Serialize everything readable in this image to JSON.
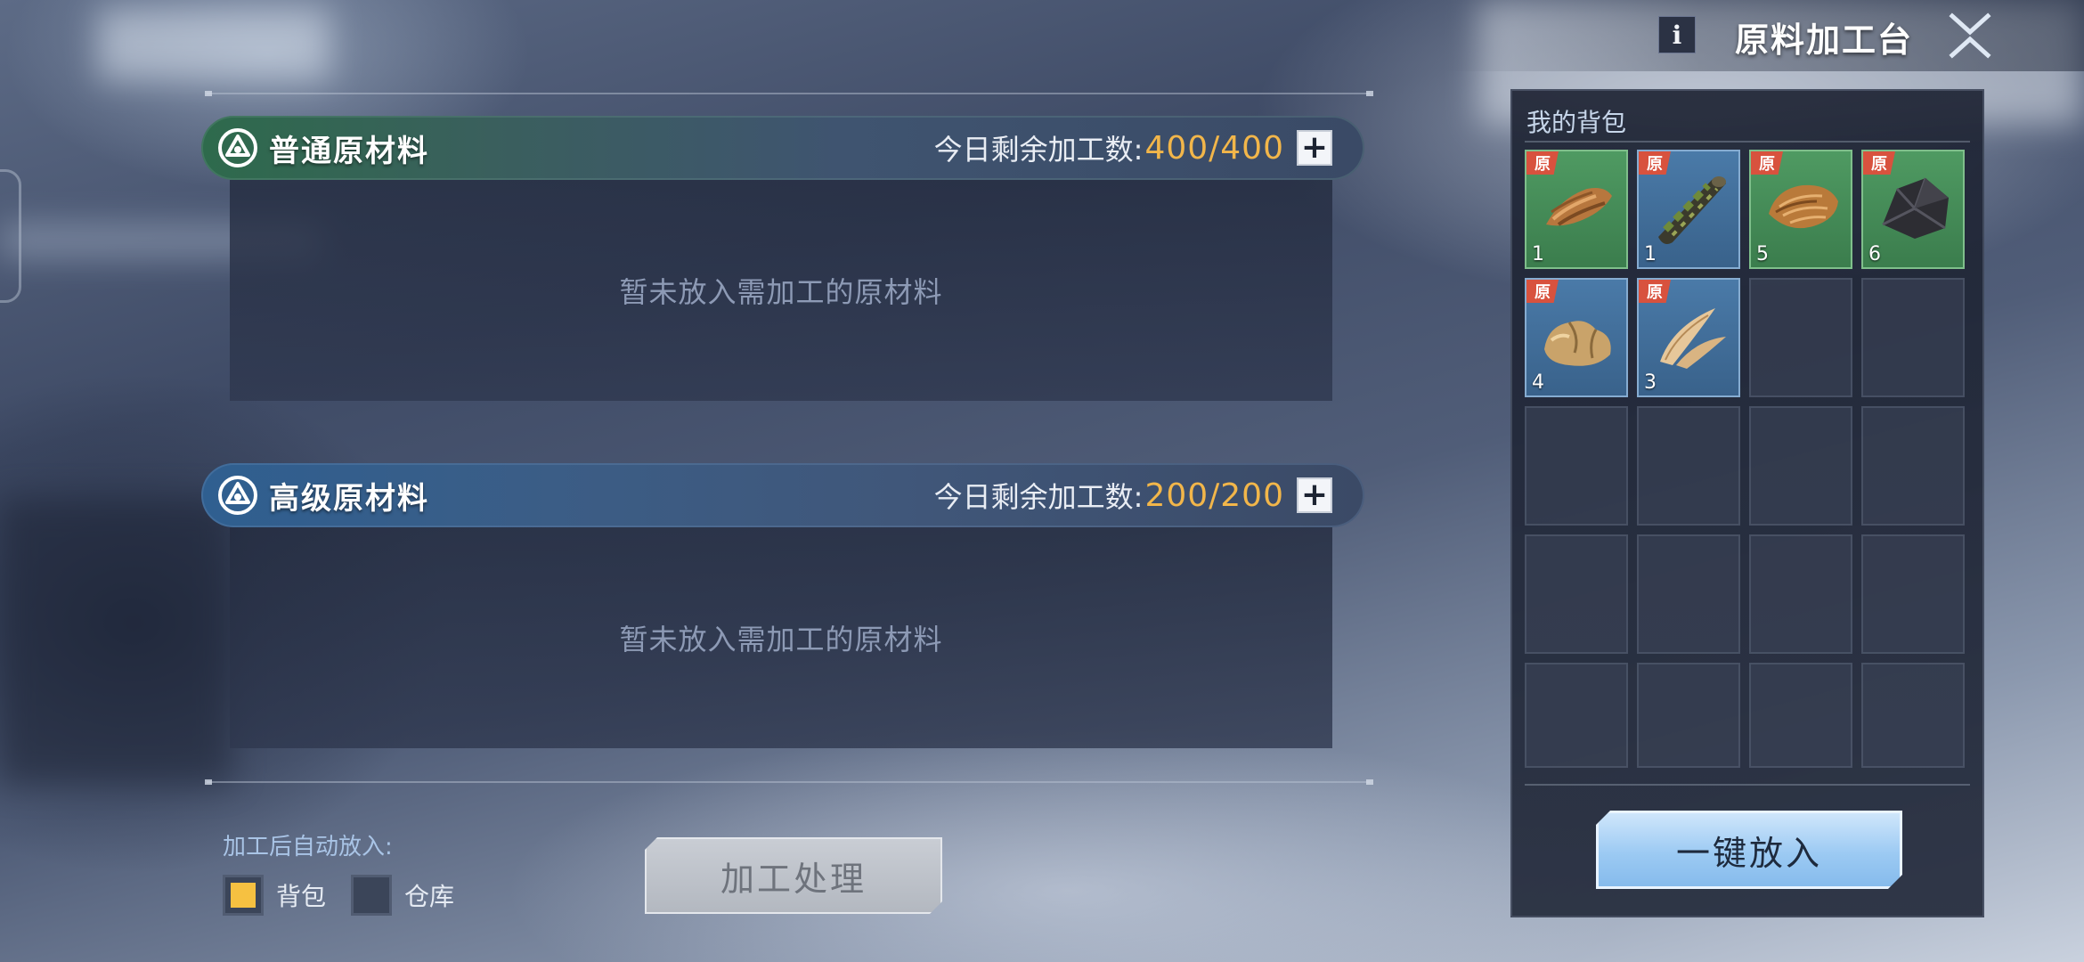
{
  "header": {
    "info_label": "i",
    "title": "原料加工台",
    "close_icon": "close-x-icon"
  },
  "sections": [
    {
      "title": "普通原材料",
      "remain_label": "今日剩余加工数:",
      "remain_value": "400/400",
      "plus_label": "+",
      "empty_text": "暂未放入需加工的原材料",
      "accent": "#2e6a4c"
    },
    {
      "title": "高级原材料",
      "remain_label": "今日剩余加工数:",
      "remain_value": "200/200",
      "plus_label": "+",
      "empty_text": "暂未放入需加工的原材料",
      "accent": "#2f5f90"
    }
  ],
  "auto": {
    "label": "加工后自动放入:",
    "options": [
      {
        "label": "背包",
        "checked": true
      },
      {
        "label": "仓库",
        "checked": false
      }
    ]
  },
  "process_button": "加工处理",
  "bag": {
    "title": "我的背包",
    "badge": "原",
    "items": [
      {
        "icon": "wood-bark-icon",
        "count": "1",
        "rarity": "green"
      },
      {
        "icon": "mossy-log-icon",
        "count": "1",
        "rarity": "blue"
      },
      {
        "icon": "fur-pelt-icon",
        "count": "5",
        "rarity": "green"
      },
      {
        "icon": "coal-ore-icon",
        "count": "6",
        "rarity": "green"
      },
      {
        "icon": "stone-ore-icon",
        "count": "4",
        "rarity": "blue"
      },
      {
        "icon": "tusk-horn-icon",
        "count": "3",
        "rarity": "blue"
      }
    ],
    "empty_slots": 14,
    "one_key_button": "一键放入"
  },
  "colors": {
    "remain_value": "#f2b64a",
    "checkbox_checked": "#f6c141",
    "raw_badge": "#d8523e"
  }
}
